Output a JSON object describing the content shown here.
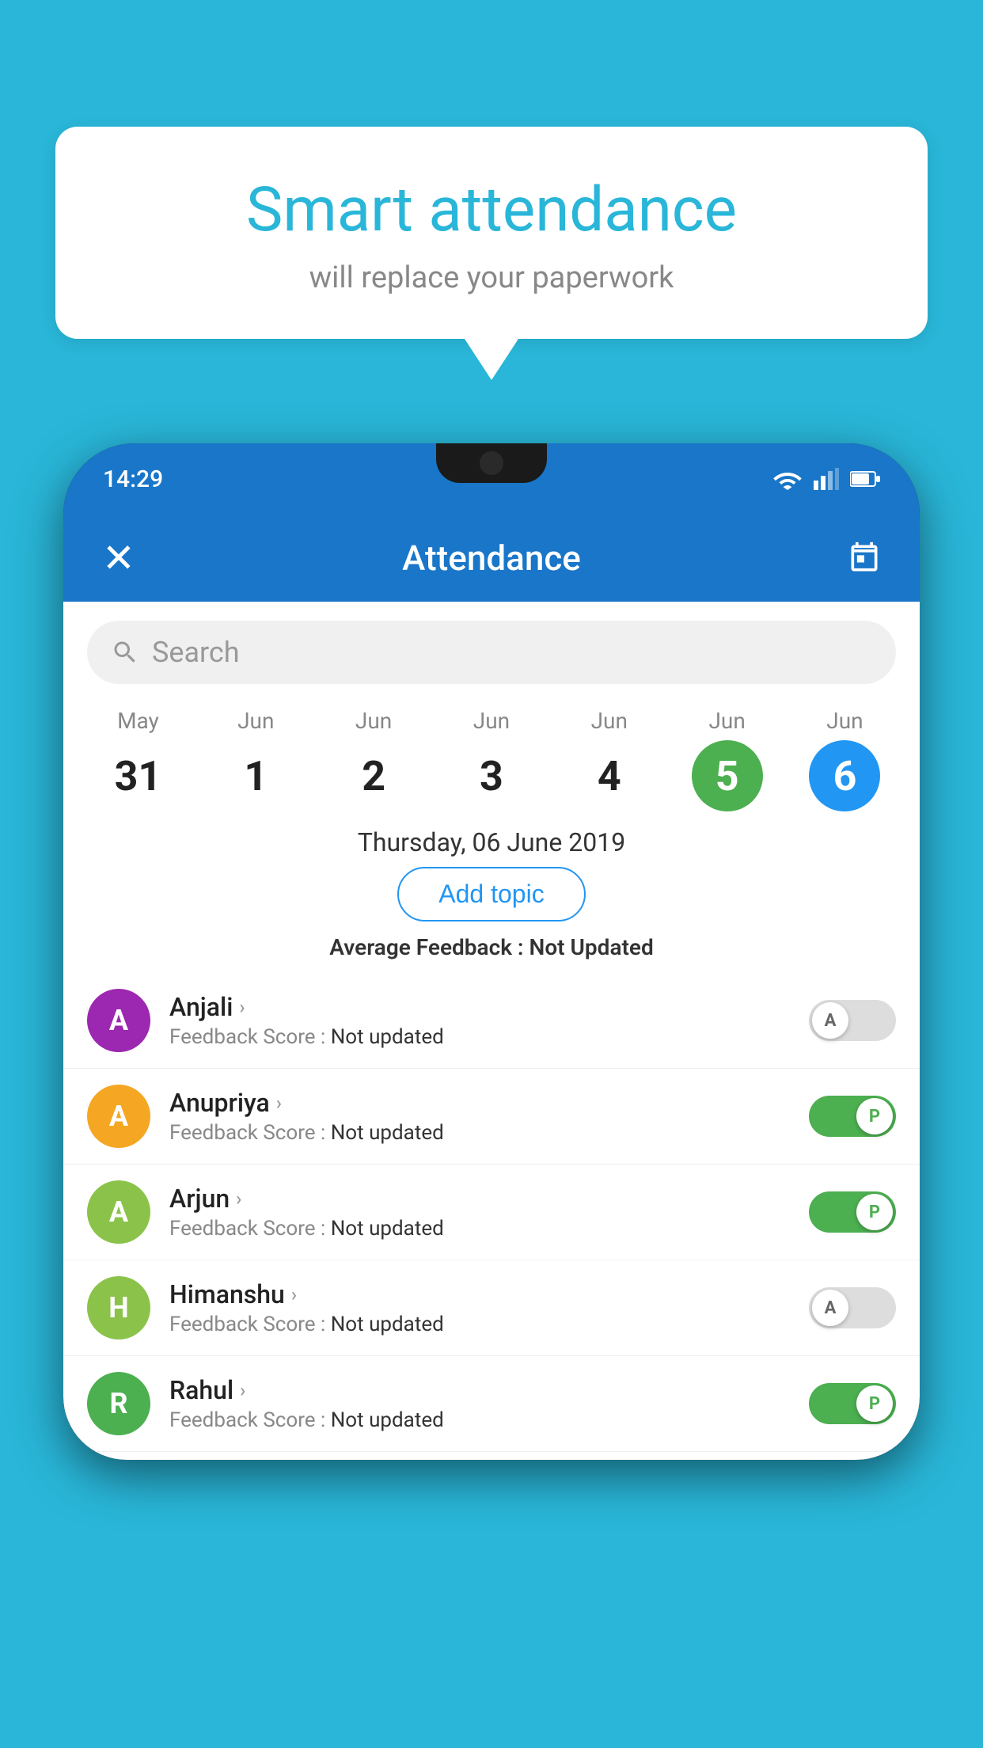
{
  "background_color": "#29b6d8",
  "speech_bubble": {
    "title": "Smart attendance",
    "subtitle": "will replace your paperwork"
  },
  "status_bar": {
    "time": "14:29"
  },
  "app_bar": {
    "title": "Attendance",
    "close_label": "×",
    "calendar_icon": "calendar"
  },
  "search": {
    "placeholder": "Search"
  },
  "calendar": {
    "days": [
      {
        "month": "May",
        "date": "31",
        "style": "normal"
      },
      {
        "month": "Jun",
        "date": "1",
        "style": "normal"
      },
      {
        "month": "Jun",
        "date": "2",
        "style": "normal"
      },
      {
        "month": "Jun",
        "date": "3",
        "style": "normal"
      },
      {
        "month": "Jun",
        "date": "4",
        "style": "normal"
      },
      {
        "month": "Jun",
        "date": "5",
        "style": "today"
      },
      {
        "month": "Jun",
        "date": "6",
        "style": "selected"
      }
    ]
  },
  "selected_date_label": "Thursday, 06 June 2019",
  "add_topic_label": "Add topic",
  "avg_feedback": {
    "label": "Average Feedback :",
    "value": "Not Updated"
  },
  "students": [
    {
      "name": "Anjali",
      "initial": "A",
      "avatar_color": "#9c27b0",
      "feedback_label": "Feedback Score :",
      "feedback_value": "Not updated",
      "toggle": "off",
      "toggle_letter": "A"
    },
    {
      "name": "Anupriya",
      "initial": "A",
      "avatar_color": "#f5a623",
      "feedback_label": "Feedback Score :",
      "feedback_value": "Not updated",
      "toggle": "on",
      "toggle_letter": "P"
    },
    {
      "name": "Arjun",
      "initial": "A",
      "avatar_color": "#8bc34a",
      "feedback_label": "Feedback Score :",
      "feedback_value": "Not updated",
      "toggle": "on",
      "toggle_letter": "P"
    },
    {
      "name": "Himanshu",
      "initial": "H",
      "avatar_color": "#8bc34a",
      "feedback_label": "Feedback Score :",
      "feedback_value": "Not updated",
      "toggle": "off",
      "toggle_letter": "A"
    },
    {
      "name": "Rahul",
      "initial": "R",
      "avatar_color": "#4caf50",
      "feedback_label": "Feedback Score :",
      "feedback_value": "Not updated",
      "toggle": "on",
      "toggle_letter": "P"
    }
  ]
}
